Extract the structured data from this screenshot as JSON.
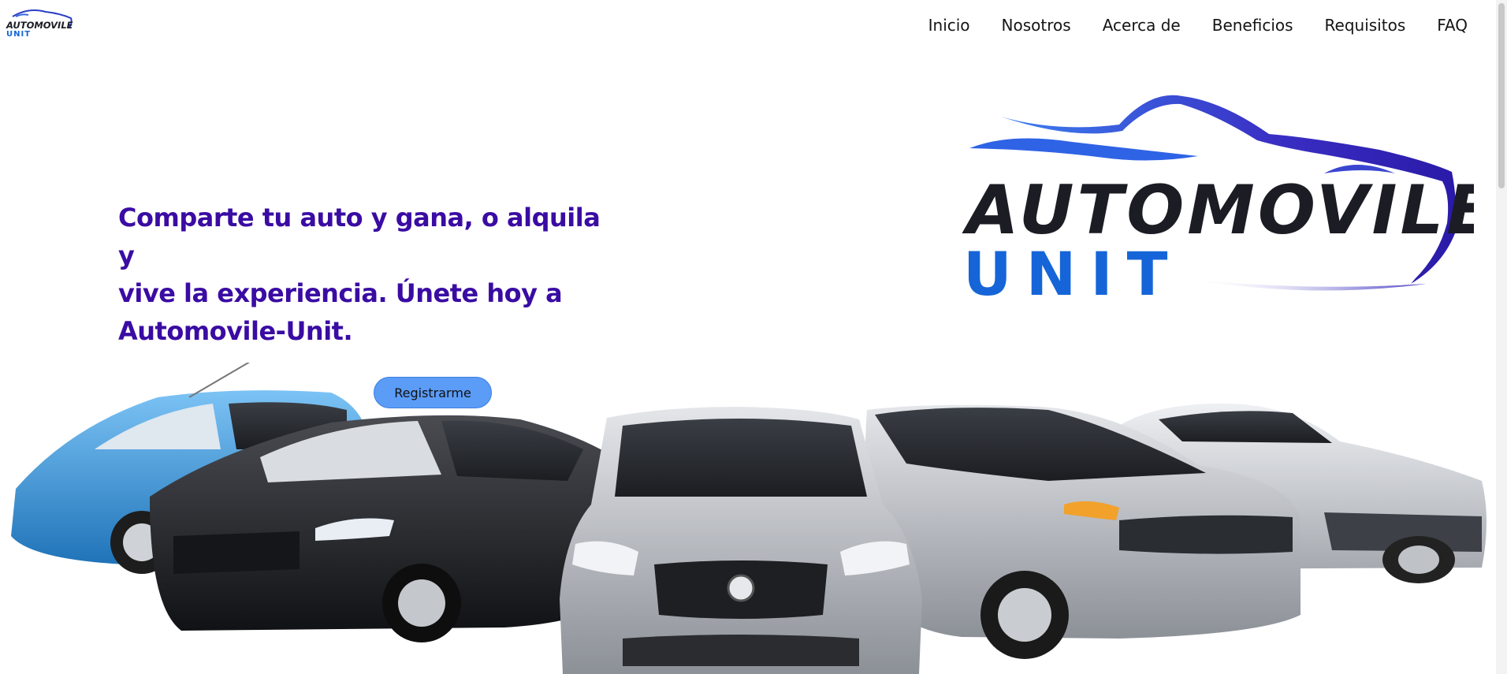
{
  "nav": {
    "brand": {
      "line1": "AUTOMOVILE",
      "line2": "UNIT"
    },
    "links": [
      "Inicio",
      "Nosotros",
      "Acerca de",
      "Beneficios",
      "Requisitos",
      "FAQ"
    ]
  },
  "hero": {
    "headline_lines": [
      "Comparte tu auto y gana, o alquila y",
      "vive la experiencia. Únete hoy a",
      "Automovile-Unit."
    ],
    "cta": "Registrarme",
    "logo": {
      "line1": "AUTOMOVILE",
      "line2": "UNIT"
    }
  },
  "theme": {
    "headline_color": "#3a0ca3",
    "button_color": "#5b9cf7",
    "logo_blue": "#1565d8",
    "logo_dark": "#1c1c24"
  }
}
